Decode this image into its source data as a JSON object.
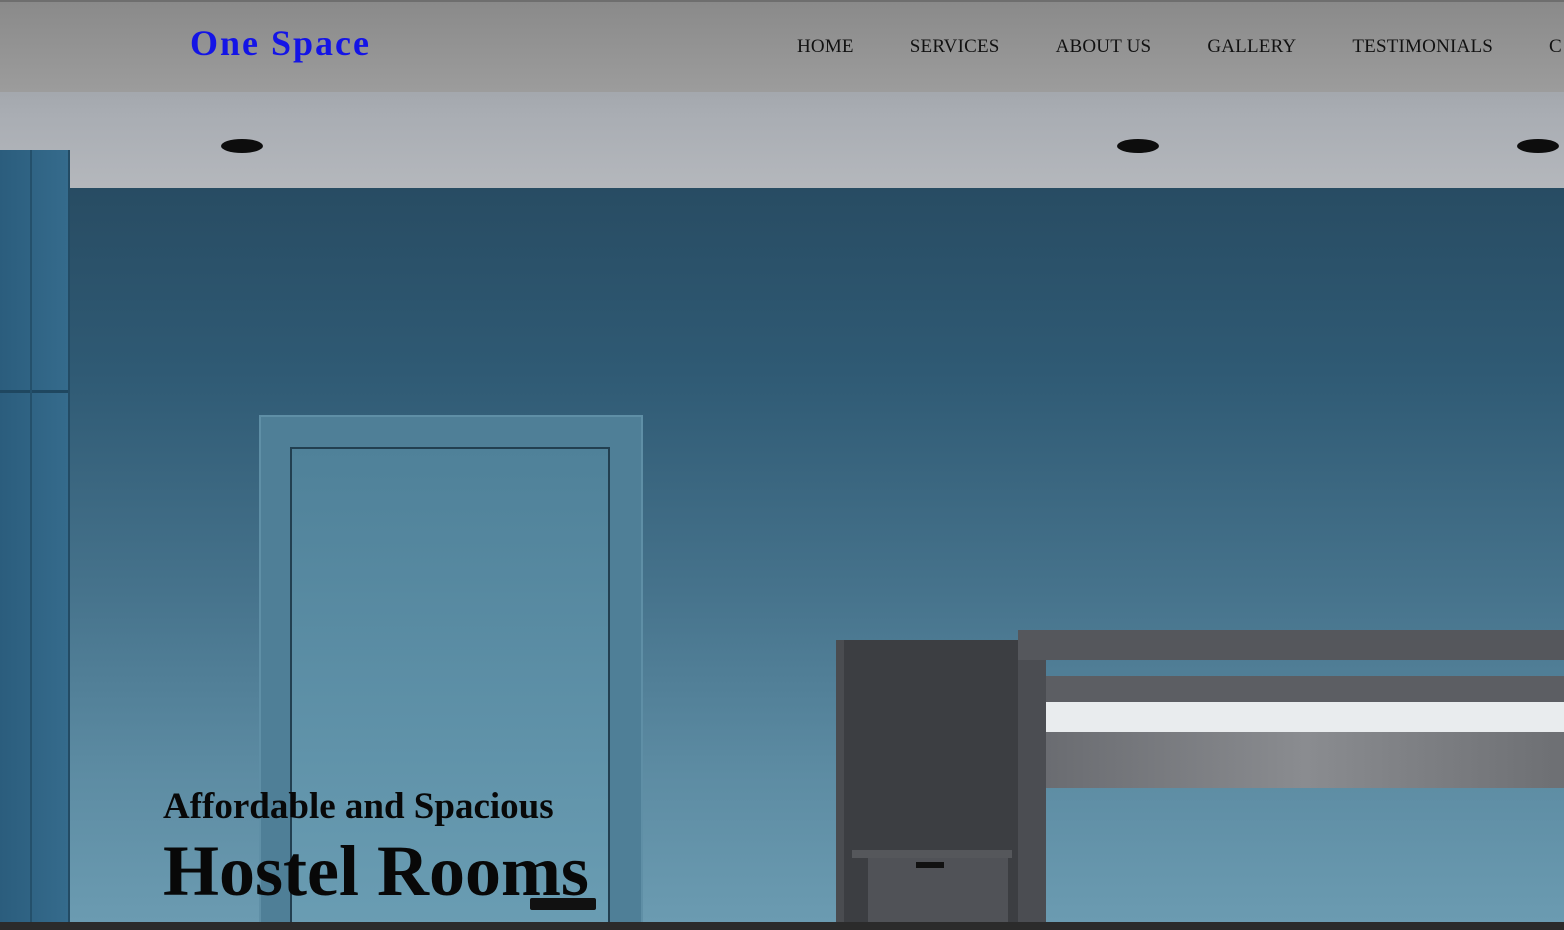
{
  "brand": {
    "name": "One Space",
    "color": "#1414e6"
  },
  "nav": {
    "items": [
      {
        "label": "HOME"
      },
      {
        "label": "SERVICES"
      },
      {
        "label": "ABOUT US"
      },
      {
        "label": "GALLERY"
      },
      {
        "label": "TESTIMONIALS"
      },
      {
        "label": "C"
      }
    ]
  },
  "hero": {
    "subtitle": "Affordable and Spacious",
    "title": "Hostel Rooms",
    "background": "hostel-room-photo"
  }
}
